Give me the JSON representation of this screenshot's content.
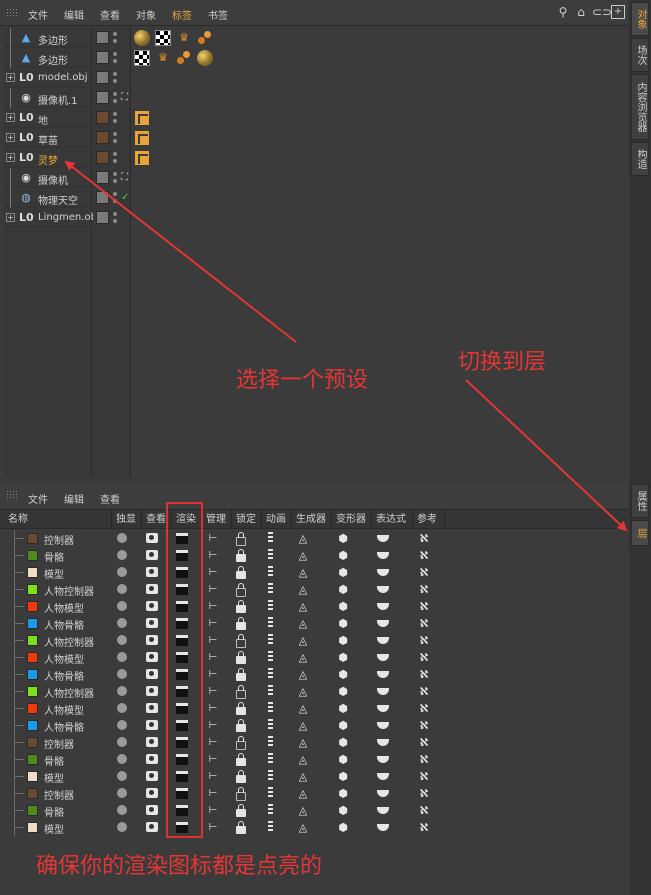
{
  "object_manager": {
    "menu": [
      "文件",
      "编辑",
      "查看",
      "对象",
      "标签",
      "书签"
    ],
    "active_menu": "标签",
    "objects": [
      {
        "name": "多边形",
        "icon": "polygon-icon",
        "glyph": "▲",
        "tags": [
          "texture-tag",
          "checker-tag",
          "crown-tag",
          "balls-tag"
        ]
      },
      {
        "name": "多边形",
        "icon": "polygon-icon",
        "glyph": "▲",
        "tags": [
          "checker-tag",
          "crown-tag",
          "balls-tag",
          "texture-tag"
        ]
      },
      {
        "name": "model.obj",
        "icon": "null-icon",
        "glyph": "L0",
        "tags": []
      },
      {
        "name": "摄像机.1",
        "icon": "camera-icon",
        "glyph": "◉",
        "tags": []
      },
      {
        "name": "地",
        "icon": "null-icon",
        "glyph": "L0",
        "tags": [
          "phong-tag"
        ]
      },
      {
        "name": "草苗",
        "icon": "null-icon",
        "glyph": "L0",
        "tags": [
          "phong-tag"
        ]
      },
      {
        "name": "灵梦",
        "icon": "null-icon",
        "glyph": "L0",
        "tags": [
          "phong-tag"
        ],
        "highlight": true
      },
      {
        "name": "摄像机",
        "icon": "camera-icon",
        "glyph": "◉",
        "tags": []
      },
      {
        "name": "物理天空",
        "icon": "sky-icon",
        "glyph": "◍",
        "tags": []
      },
      {
        "name": "Lingmen.obj",
        "icon": "null-icon",
        "glyph": "L0",
        "tags": []
      }
    ]
  },
  "right_tabs": [
    "对象",
    "场次",
    "内容浏览器",
    "构造",
    "属性",
    "层"
  ],
  "layer_manager": {
    "menu": [
      "文件",
      "编辑",
      "查看"
    ],
    "columns": [
      "名称",
      "独显",
      "查看",
      "渲染",
      "管理",
      "锁定",
      "动画",
      "生成器",
      "变形器",
      "表达式",
      "参考"
    ],
    "layers": [
      {
        "name": "控制器",
        "color": "#6b4a32",
        "locked": false
      },
      {
        "name": "骨骼",
        "color": "#4f8a1c",
        "locked": true
      },
      {
        "name": "模型",
        "color": "#efdcc4",
        "locked": true
      },
      {
        "name": "人物控制器",
        "color": "#7ee01a",
        "locked": false
      },
      {
        "name": "人物模型",
        "color": "#f0380a",
        "locked": true
      },
      {
        "name": "人物骨骼",
        "color": "#1a9ae8",
        "locked": true
      },
      {
        "name": "人物控制器",
        "color": "#7ee01a",
        "locked": false
      },
      {
        "name": "人物模型",
        "color": "#f0380a",
        "locked": true
      },
      {
        "name": "人物骨骼",
        "color": "#1a9ae8",
        "locked": true
      },
      {
        "name": "人物控制器",
        "color": "#7ee01a",
        "locked": false
      },
      {
        "name": "人物模型",
        "color": "#f0380a",
        "locked": true
      },
      {
        "name": "人物骨骼",
        "color": "#1a9ae8",
        "locked": true
      },
      {
        "name": "控制器",
        "color": "#6b4a32",
        "locked": false
      },
      {
        "name": "骨骼",
        "color": "#4f8a1c",
        "locked": true
      },
      {
        "name": "模型",
        "color": "#efdcc4",
        "locked": true
      },
      {
        "name": "控制器",
        "color": "#6b4a32",
        "locked": false
      },
      {
        "name": "骨骼",
        "color": "#4f8a1c",
        "locked": true
      },
      {
        "name": "模型",
        "color": "#efdcc4",
        "locked": true
      }
    ]
  },
  "annotations": {
    "select_preset": "选择一个预设",
    "switch_layer": "切换到层",
    "render_note": "确保你的渲染图标都是点亮的",
    "color": "#e53535"
  }
}
